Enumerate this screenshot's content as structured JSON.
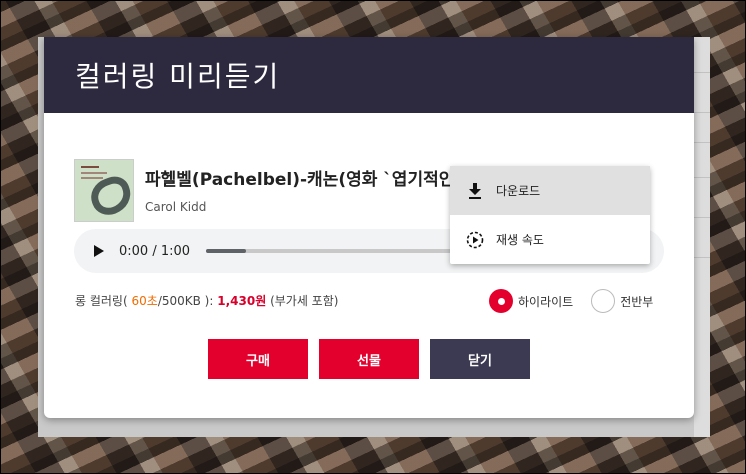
{
  "dialog": {
    "title": "컬러링 미리듣기",
    "track": {
      "title": "파헬벨(Pachelbel)-캐논(영화 `엽기적인그녀`)",
      "artist": "Carol Kidd"
    },
    "player": {
      "time": "0:00 / 1:00",
      "progress_fraction": 0.16
    },
    "info": {
      "prefix": "롱 컬러링(",
      "seconds": "60초",
      "size": "/500KB ):",
      "price": "1,430원",
      "vat": "(부가세 포함)"
    },
    "options": {
      "highlight": "하이라이트",
      "first_half": "전반부",
      "selected": "highlight"
    },
    "buttons": {
      "buy": "구매",
      "gift": "선물",
      "close": "닫기"
    }
  },
  "context_menu": {
    "download": "다운로드",
    "speed": "재생 속도"
  },
  "colors": {
    "header": "#2d2a3f",
    "accent": "#e3002d",
    "close_button": "#3c3a52",
    "orange": "#ef6c00"
  }
}
